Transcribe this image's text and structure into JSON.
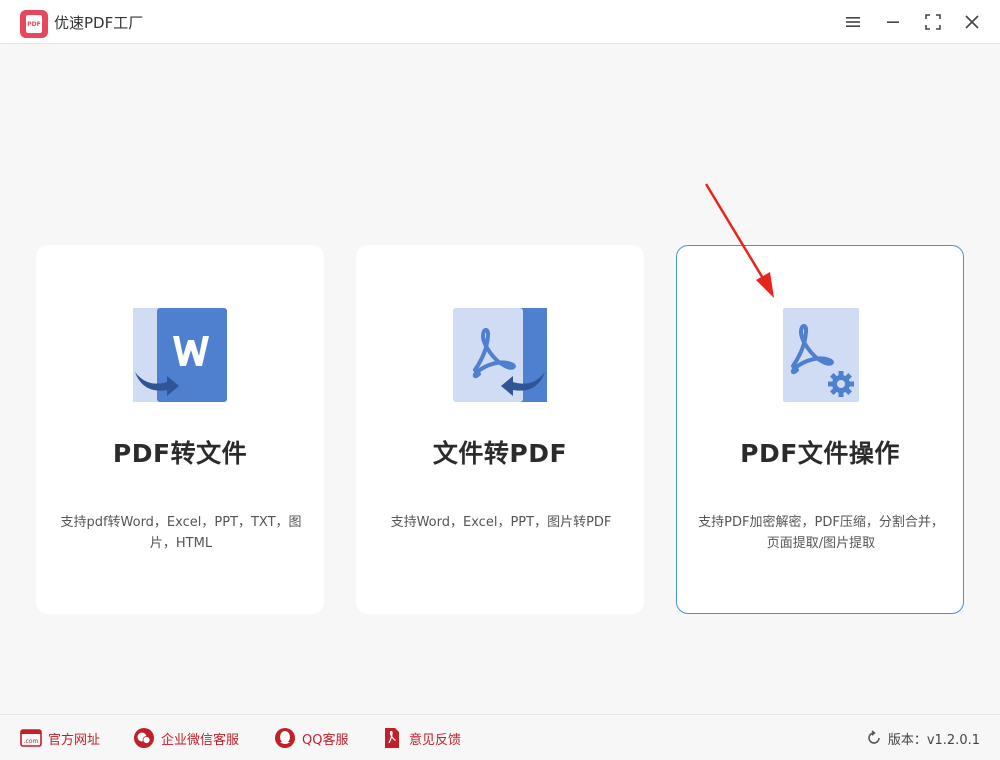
{
  "app": {
    "title": "优速PDF工厂",
    "logo_text": "PDF"
  },
  "cards": [
    {
      "title": "PDF转文件",
      "description": "支持pdf转Word，Excel，PPT，TXT，图片，HTML",
      "icon": "pdf-to-word-icon",
      "active": false
    },
    {
      "title": "文件转PDF",
      "description": "支持Word，Excel，PPT，图片转PDF",
      "icon": "file-to-pdf-icon",
      "active": false
    },
    {
      "title": "PDF文件操作",
      "description": "支持PDF加密解密，PDF压缩，分割合并，页面提取/图片提取",
      "icon": "pdf-settings-icon",
      "active": true
    }
  ],
  "footer": {
    "links": [
      {
        "label": "官方网址",
        "icon": "website-icon"
      },
      {
        "label": "企业微信客服",
        "icon": "wechat-icon"
      },
      {
        "label": "QQ客服",
        "icon": "qq-icon"
      },
      {
        "label": "意见反馈",
        "icon": "feedback-icon"
      }
    ],
    "version": "版本：v1.2.0.1"
  },
  "colors": {
    "accent": "#4a90d9",
    "brand": "#e8455f",
    "footer_link": "#c0202a",
    "icon_dark": "#4f7fcf",
    "icon_light": "#cfdcf3",
    "annotation": "#e8241c"
  }
}
